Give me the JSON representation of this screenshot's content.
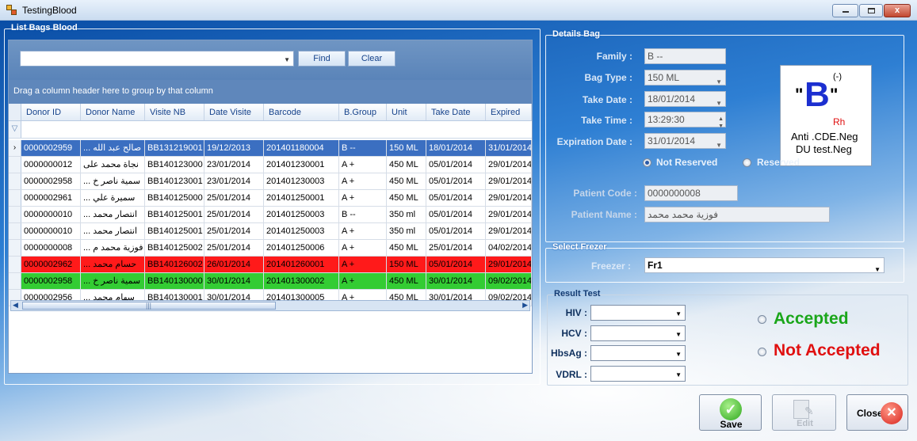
{
  "window": {
    "title": "TestingBlood",
    "min": "▭",
    "max": "□",
    "close": "x"
  },
  "list_panel": {
    "title": "List Bags Blood",
    "find_value": "",
    "find_label": "Find",
    "clear_label": "Clear",
    "group_hint": "Drag a column header here to group by that column",
    "columns": [
      "Donor ID",
      "Donor Name",
      "Visite NB",
      "Date Visite",
      "Barcode",
      "B.Group",
      "Unit",
      "Take Date",
      "Expired Da"
    ],
    "rows": [
      {
        "style": "sel",
        "cells": [
          "0000002959",
          "... صالح عبد الله",
          "BB131219001",
          "19/12/2013",
          "201401180004",
          "B --",
          "150 ML",
          "18/01/2014",
          "31/01/2014"
        ]
      },
      {
        "style": "",
        "cells": [
          "0000000012",
          "نجاة محمد على",
          "BB140123000",
          "23/01/2014",
          "201401230001",
          "A +",
          "450 ML",
          "05/01/2014",
          "29/01/2014"
        ]
      },
      {
        "style": "",
        "cells": [
          "0000002958",
          "... سمية ناصر خ",
          "BB140123001",
          "23/01/2014",
          "201401230003",
          "A +",
          "450 ML",
          "05/01/2014",
          "29/01/2014"
        ]
      },
      {
        "style": "",
        "cells": [
          "0000002961",
          "... سميرة علي",
          "BB140125000",
          "25/01/2014",
          "201401250001",
          "A +",
          "450 ML",
          "05/01/2014",
          "29/01/2014"
        ]
      },
      {
        "style": "",
        "cells": [
          "0000000010",
          "... انتصار محمد",
          "BB140125001",
          "25/01/2014",
          "201401250003",
          "B --",
          "350 ml",
          "05/01/2014",
          "29/01/2014"
        ]
      },
      {
        "style": "",
        "cells": [
          "0000000010",
          "... انتصار محمد",
          "BB140125001",
          "25/01/2014",
          "201401250003",
          "A +",
          "350 ml",
          "05/01/2014",
          "29/01/2014"
        ]
      },
      {
        "style": "",
        "cells": [
          "0000000008",
          "... فوزية محمد م",
          "BB140125002",
          "25/01/2014",
          "201401250006",
          "A +",
          "450 ML",
          "25/01/2014",
          "04/02/2014"
        ]
      },
      {
        "style": "red",
        "cells": [
          "0000002962",
          "... حسام محمد",
          "BB140126002",
          "26/01/2014",
          "201401260001",
          "A +",
          "150 ML",
          "05/01/2014",
          "29/01/2014"
        ]
      },
      {
        "style": "green",
        "cells": [
          "0000002958",
          "... سمية ناصر خ",
          "BB140130000",
          "30/01/2014",
          "201401300002",
          "A +",
          "450 ML",
          "30/01/2014",
          "09/02/2014"
        ]
      },
      {
        "style": "",
        "cells": [
          "0000002956",
          "... سهام محمد",
          "BB140130001",
          "30/01/2014",
          "201401300005",
          "A +",
          "450 ML",
          "30/01/2014",
          "09/02/2014"
        ]
      }
    ]
  },
  "details": {
    "title": "Details Bag",
    "family_label": "Family :",
    "family_value": "B --",
    "bagtype_label": "Bag Type :",
    "bagtype_value": "150 ML",
    "takedate_label": "Take Date :",
    "takedate_value": "18/01/2014",
    "taketime_label": "Take Time :",
    "taketime_value": "13:29:30",
    "expdate_label": "Expiration  Date :",
    "expdate_value": "31/01/2014",
    "not_reserved_label": "Not Reserved",
    "reserved_label": "Reserved",
    "patient_code_label": "Patient Code :",
    "patient_code_value": "0000000008",
    "patient_name_label": "Patient Name :",
    "patient_name_value": "فوزية محمد محمد",
    "card": {
      "group": "B",
      "sign": "(-)",
      "rh": "Rh",
      "line1": "Anti .CDE.Neg",
      "line2": "DU test.Neg"
    }
  },
  "freezer": {
    "title": "Select Frezer",
    "label": "Freezer :",
    "value": "Fr1"
  },
  "result": {
    "title": "Result Test",
    "hiv_label": "HIV :",
    "hcv_label": "HCV :",
    "hbsag_label": "HbsAg :",
    "vdrl_label": "VDRL :",
    "accepted_label": "Accepted",
    "not_accepted_label": "Not Accepted"
  },
  "buttons": {
    "save": "Save",
    "edit": "Edit",
    "close": "Close"
  },
  "colors": {
    "accepted": "#1aa61a",
    "not_accepted": "#e01010",
    "selected_row": "#3b6fc1",
    "red_row": "#ff1a1a",
    "green_row": "#33cc33"
  }
}
